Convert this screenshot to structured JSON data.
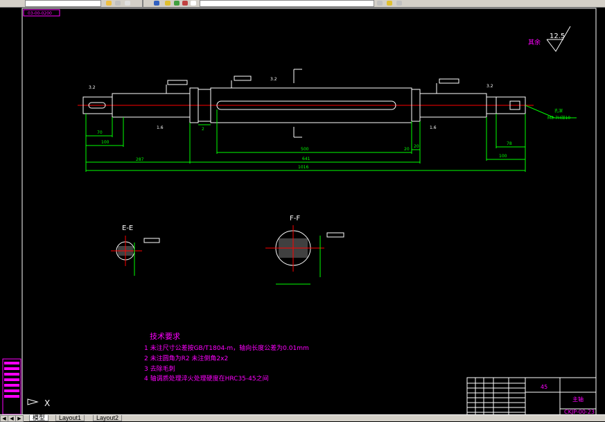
{
  "toolbar": {
    "combo_left_text": "",
    "combo_right_text": ""
  },
  "drawing": {
    "frame_tag": "03-00-0200",
    "roughness_note": "其余",
    "roughness_value": "12.5",
    "dims": {
      "d70": "70",
      "d100": "100",
      "d2": "2",
      "d500": "500",
      "d20": "20",
      "d20b": "20",
      "d287": "287",
      "d641": "641",
      "d1016": "1016",
      "d78": "78",
      "d100r": "100",
      "rough32a": "3.2",
      "rough32b": "3.2",
      "rough32c": "3.2",
      "rough16a": "1.6",
      "rough16b": "1.6",
      "thread_note": "M8-7H深10",
      "thread_note2": "孔深"
    },
    "section_e": "E-E",
    "section_f": "F-F",
    "tech": {
      "title": "技术要求",
      "items": [
        "1  未注尺寸公差按GB/T1804-m，轴向长度公差为0.01mm",
        "2  未注圆角为R2  未注倒角2x2",
        "3  去除毛刺",
        "4  轴调质处理淬火处理硬度在HRC35-45之间"
      ]
    },
    "title_block": {
      "material": "45",
      "name": "主轴",
      "number": "CKJP-00-23"
    }
  },
  "side_toolbar": {
    "axis_x": "X"
  },
  "tabs": {
    "model": "模型",
    "layout1": "Layout1",
    "layout2": "Layout2"
  },
  "colors": {
    "background": "#000000",
    "geometry": "#ffffff",
    "dimension": "#00ff00",
    "centerline": "#ff0000",
    "text": "#ff00ff"
  }
}
